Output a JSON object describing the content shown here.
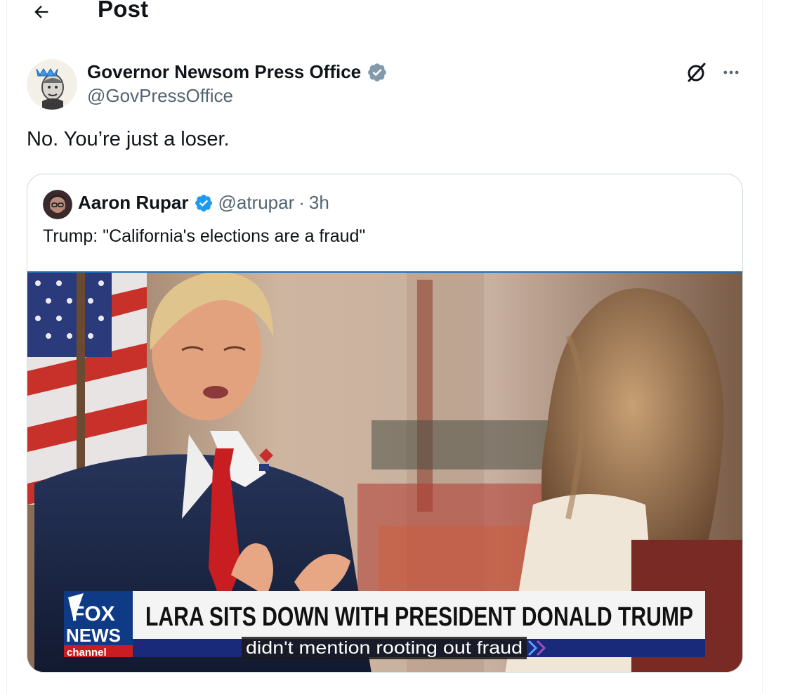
{
  "header": {
    "title": "Post"
  },
  "post": {
    "author_name": "Governor Newsom Press Office",
    "author_handle": "@GovPressOffice",
    "text": "No. You’re just a loser."
  },
  "quote": {
    "author_name": "Aaron Rupar",
    "author_handle": "@atrupar",
    "separator": "·",
    "time": "3h",
    "text": "Trump: \"California's elections are a fraud\""
  },
  "video": {
    "network_line1": "FOX",
    "network_line2": "NEWS",
    "network_line3": "channel",
    "chyron": "LARA SITS DOWN WITH PRESIDENT DONALD TRUMP",
    "caption": "didn't mention rooting out fraud"
  },
  "colors": {
    "verified_gov": "#829aab",
    "verified_blue": "#1d9bf0",
    "secondary_text": "#536471",
    "border": "#cfd9de"
  }
}
